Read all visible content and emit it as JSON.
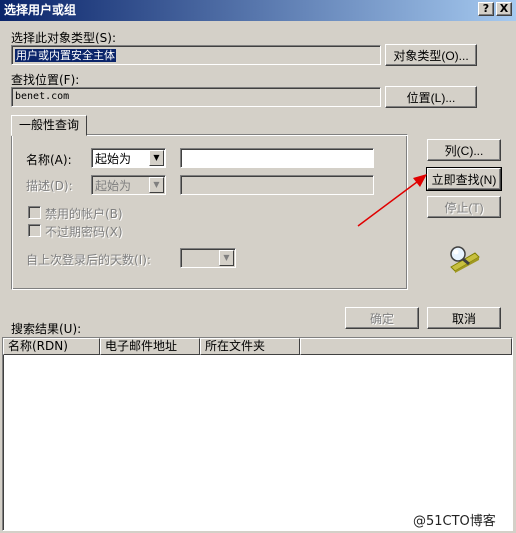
{
  "window": {
    "title": "选择用户或组",
    "help_btn": "?",
    "close_btn": "X"
  },
  "object_type": {
    "label": "选择此对象类型(S):",
    "value": "用户或内置安全主体",
    "button": "对象类型(O)..."
  },
  "location": {
    "label": "查找位置(F):",
    "value": "benet.com",
    "button": "位置(L)..."
  },
  "query": {
    "tab_label": "一般性查询",
    "name_label": "名称(A):",
    "name_mode": "起始为",
    "name_value": "",
    "desc_label": "描述(D):",
    "desc_mode": "起始为",
    "desc_value": "",
    "disabled_accounts": "禁用的帐户(B)",
    "no_expire_pwd": "不过期密码(X)",
    "days_label": "自上次登录后的天数(I):",
    "days_value": ""
  },
  "actions": {
    "columns": "列(C)...",
    "find_now": "立即查找(N)",
    "stop": "停止(T)",
    "ok": "确定",
    "cancel": "取消"
  },
  "results": {
    "label": "搜索结果(U):",
    "columns": [
      "名称(RDN)",
      "电子邮件地址",
      "所在文件夹"
    ]
  },
  "icons": {
    "search": "magnifier-icon",
    "arrow": "red-arrow-annotation"
  },
  "colors": {
    "title_start": "#0a246a",
    "title_end": "#a6caf0",
    "face": "#d4d0c8",
    "arrow": "#e00000"
  },
  "watermark": "@51CTO博客"
}
